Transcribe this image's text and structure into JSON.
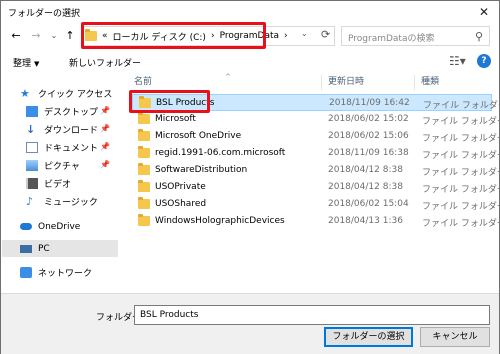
{
  "window": {
    "title": "フォルダーの選択",
    "close_symbol": "✕"
  },
  "nav": {
    "back": "←",
    "forward": "→",
    "dropdown": "⌄",
    "up": "↑"
  },
  "address": {
    "prefix": "«",
    "segments": [
      "ローカル ディスク (C:)",
      "ProgramData"
    ],
    "separator": "›",
    "dropdown": "⌄",
    "refresh": "⟳"
  },
  "search": {
    "placeholder": "ProgramDataの検索",
    "icon": "⚲"
  },
  "toolbar": {
    "organize": "整理",
    "organize_arrow": "▼",
    "new_folder": "新しいフォルダー",
    "view_icon": "☷▾",
    "help": "?"
  },
  "sidebar": {
    "items": [
      {
        "label": "クイック アクセス",
        "icon": "star-icon",
        "color": "#2b7cd3",
        "pinned": false
      },
      {
        "label": "デスクトップ",
        "icon": "desktop-icon",
        "color": "#3a8ee6",
        "pinned": true
      },
      {
        "label": "ダウンロード",
        "icon": "download-icon",
        "color": "#2d6cc0",
        "pinned": true
      },
      {
        "label": "ドキュメント",
        "icon": "documents-icon",
        "color": "#6f8db4",
        "pinned": true
      },
      {
        "label": "ピクチャ",
        "icon": "pictures-icon",
        "color": "#4a8fd0",
        "pinned": true
      },
      {
        "label": "ビデオ",
        "icon": "videos-icon",
        "color": "#555",
        "pinned": false
      },
      {
        "label": "ミュージック",
        "icon": "music-icon",
        "color": "#2b7cd3",
        "pinned": false
      },
      {
        "label": "OneDrive",
        "icon": "onedrive-icon",
        "color": "#1e78d4",
        "pinned": false
      },
      {
        "label": "PC",
        "icon": "pc-icon",
        "color": "#3a6ea5",
        "pinned": false
      },
      {
        "label": "ネットワーク",
        "icon": "network-icon",
        "color": "#3a8ee6",
        "pinned": false
      }
    ],
    "pin_symbol": "📌"
  },
  "list": {
    "columns": {
      "name": "名前",
      "date": "更新日時",
      "type": "種類"
    },
    "sort_arrow": "^",
    "rows": [
      {
        "name": "BSL Products",
        "date": "2018/11/09 16:42",
        "type": "ファイル フォルダー",
        "selected": true
      },
      {
        "name": "Microsoft",
        "date": "2018/06/02 15:02",
        "type": "ファイル フォルダー",
        "selected": false
      },
      {
        "name": "Microsoft OneDrive",
        "date": "2018/06/02 15:06",
        "type": "ファイル フォルダー",
        "selected": false
      },
      {
        "name": "regid.1991-06.com.microsoft",
        "date": "2018/11/09 16:38",
        "type": "ファイル フォルダー",
        "selected": false
      },
      {
        "name": "SoftwareDistribution",
        "date": "2018/04/12 8:38",
        "type": "ファイル フォルダー",
        "selected": false
      },
      {
        "name": "USOPrivate",
        "date": "2018/04/12 8:38",
        "type": "ファイル フォルダー",
        "selected": false
      },
      {
        "name": "USOShared",
        "date": "2018/06/02 15:04",
        "type": "ファイル フォルダー",
        "selected": false
      },
      {
        "name": "WindowsHolographicDevices",
        "date": "2018/04/13 1:36",
        "type": "ファイル フォルダー",
        "selected": false
      }
    ]
  },
  "footer": {
    "folder_label": "フォルダー:",
    "folder_value": "BSL Products",
    "select_button": "フォルダーの選択",
    "cancel_button": "キャンセル"
  },
  "colors": {
    "highlight": "#e8111b",
    "selection": "#cce8ff"
  }
}
